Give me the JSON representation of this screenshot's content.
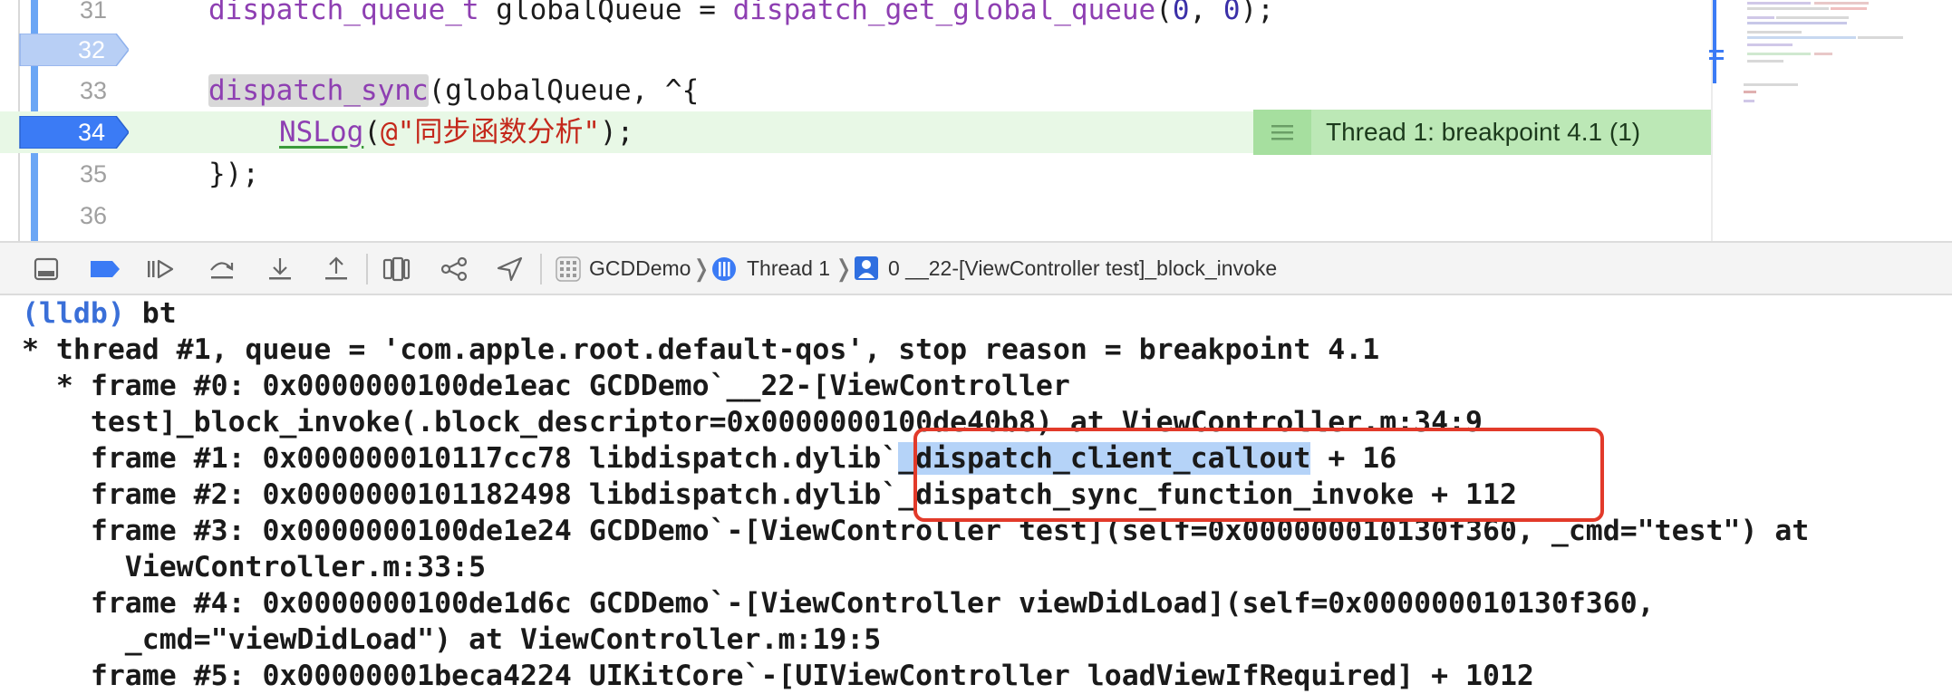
{
  "editor": {
    "lines": [
      {
        "num": "31",
        "text": "dispatch_queue_t globalQueue = dispatch_get_global_queue(0, 0);",
        "breakpoint": false
      },
      {
        "num": "32",
        "text": "",
        "breakpoint": true
      },
      {
        "num": "33",
        "text": "dispatch_sync(globalQueue, ^{",
        "breakpoint": false
      },
      {
        "num": "34",
        "text": "NSLog(@\"同步函数分析\");",
        "breakpoint": true,
        "current": true
      },
      {
        "num": "35",
        "text": "});",
        "breakpoint": false
      },
      {
        "num": "36",
        "text": "",
        "breakpoint": false
      }
    ],
    "tokens": {
      "l31_type": "dispatch_queue_t",
      "l31_var": " globalQueue = ",
      "l31_fn": "dispatch_get_global_queue",
      "l31_open": "(",
      "l31_n1": "0",
      "l31_comma": ", ",
      "l31_n2": "0",
      "l31_close": ");",
      "l33_fn": "dispatch_sync",
      "l33_rest": "(globalQueue, ^{",
      "l34_fn": "NSLog",
      "l34_open": "(",
      "l34_str": "@\"同步函数分析\"",
      "l34_close": ");",
      "l35": "});"
    },
    "banner": {
      "text": "Thread 1: breakpoint 4.1 (1)",
      "icon": "lines-icon"
    }
  },
  "debug_bar": {
    "buttons": [
      {
        "name": "hide-debug-area-button",
        "icon": "panel-icon"
      },
      {
        "name": "breakpoints-toggle-button",
        "icon": "breakpoint-icon",
        "active": true
      },
      {
        "name": "continue-button",
        "icon": "continue-icon"
      },
      {
        "name": "step-over-button",
        "icon": "step-over-icon"
      },
      {
        "name": "step-into-button",
        "icon": "step-into-icon"
      },
      {
        "name": "step-out-button",
        "icon": "step-out-icon"
      },
      {
        "name": "view-debugger-button",
        "icon": "view-hierarchy-icon"
      },
      {
        "name": "memory-graph-button",
        "icon": "memory-graph-icon"
      },
      {
        "name": "simulate-location-button",
        "icon": "location-icon"
      }
    ],
    "breadcrumbs": {
      "app": "GCDDemo",
      "thread": "Thread 1",
      "frame": "0 __22-[ViewController test]_block_invoke"
    }
  },
  "console": {
    "prompt": "(lldb)",
    "command": " bt",
    "l1": "* thread #1, queue = 'com.apple.root.default-qos', stop reason = breakpoint 4.1",
    "l2": "  * frame #0: 0x0000000100de1eac GCDDemo`__22-[ViewController",
    "l3": "    test]_block_invoke(.block_descriptor=0x0000000100de40b8) at ViewController.m:34:9",
    "l4_pre": "    frame #1: 0x000000010117cc78 libdispatch.dylib`",
    "l4_sel": "_dispatch_client_callout",
    "l4_post": " + 16",
    "l5": "    frame #2: 0x0000000101182498 libdispatch.dylib`_dispatch_sync_function_invoke + 112",
    "l6": "    frame #3: 0x0000000100de1e24 GCDDemo`-[ViewController test](self=0x000000010130f360, _cmd=\"test\") at",
    "l7": "      ViewController.m:33:5",
    "l8": "    frame #4: 0x0000000100de1d6c GCDDemo`-[ViewController viewDidLoad](self=0x000000010130f360,",
    "l9": "      _cmd=\"viewDidLoad\") at ViewController.m:19:5",
    "l10": "    frame #5: 0x00000001beca4224 UIKitCore`-[UIViewController loadViewIfRequired] + 1012"
  },
  "colors": {
    "breakpoint": "#3b7bf5",
    "breakpoint_light": "#b8cff5",
    "current_line": "#e8f8e6",
    "banner": "#bce8b6",
    "annotation": "#e23a2a",
    "selection": "#b5d3f8"
  }
}
